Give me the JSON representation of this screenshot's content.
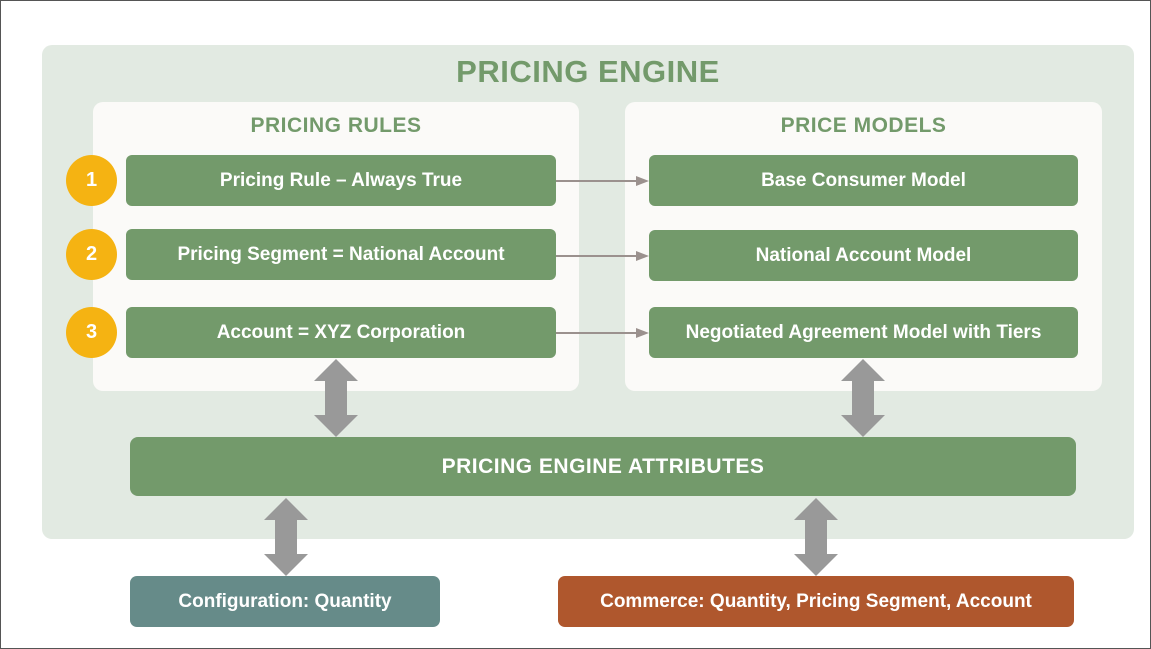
{
  "diagram": {
    "title": "PRICING ENGINE",
    "pricing_rules": {
      "title": "PRICING RULES",
      "items": [
        {
          "number": "1",
          "label": "Pricing Rule – Always True"
        },
        {
          "number": "2",
          "label": "Pricing Segment = National Account"
        },
        {
          "number": "3",
          "label": "Account = XYZ Corporation"
        }
      ]
    },
    "price_models": {
      "title": "PRICE MODELS",
      "items": [
        {
          "label": "Base Consumer Model"
        },
        {
          "label": "National Account Model"
        },
        {
          "label": "Negotiated Agreement Model with Tiers"
        }
      ]
    },
    "attributes": {
      "label": "PRICING ENGINE ATTRIBUTES"
    },
    "sources": {
      "configuration": {
        "label": "Configuration: Quantity"
      },
      "commerce": {
        "label": "Commerce: Quantity, Pricing Segment, Account"
      }
    },
    "colors": {
      "engine_bg": "#e2eae2",
      "panel_bg": "#fbfaf8",
      "green": "#739a6b",
      "badge": "#f5b312",
      "configuration": "#668b89",
      "commerce": "#af572d",
      "arrow": "#999999",
      "connector": "#9b918e"
    }
  }
}
